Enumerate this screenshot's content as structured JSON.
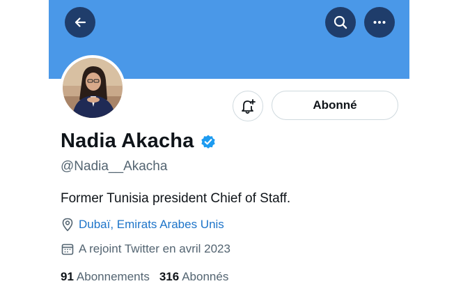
{
  "header": {
    "back_icon": "arrow-left-icon",
    "search_icon": "search-icon",
    "more_icon": "more-horizontal-icon",
    "banner_color": "#4a98e8",
    "button_color": "#1f3d6b"
  },
  "profile": {
    "display_name": "Nadia Akacha",
    "verified_icon": "verified-badge-icon",
    "verified_color": "#1d9bf0",
    "handle": "@Nadia__Akacha",
    "bio": "Former Tunisia president Chief of Staff.",
    "location_icon": "map-pin-icon",
    "location": "Dubaï, Emirats Arabes Unis",
    "location_color": "#1d74c9",
    "joined_icon": "calendar-icon",
    "joined": "A rejoint Twitter en avril 2023"
  },
  "actions": {
    "notify_icon": "bell-plus-icon",
    "follow_label": "Abonné"
  },
  "stats": {
    "following_count": "91",
    "following_label": "Abonnements",
    "followers_count": "316",
    "followers_label": "Abonnés"
  }
}
